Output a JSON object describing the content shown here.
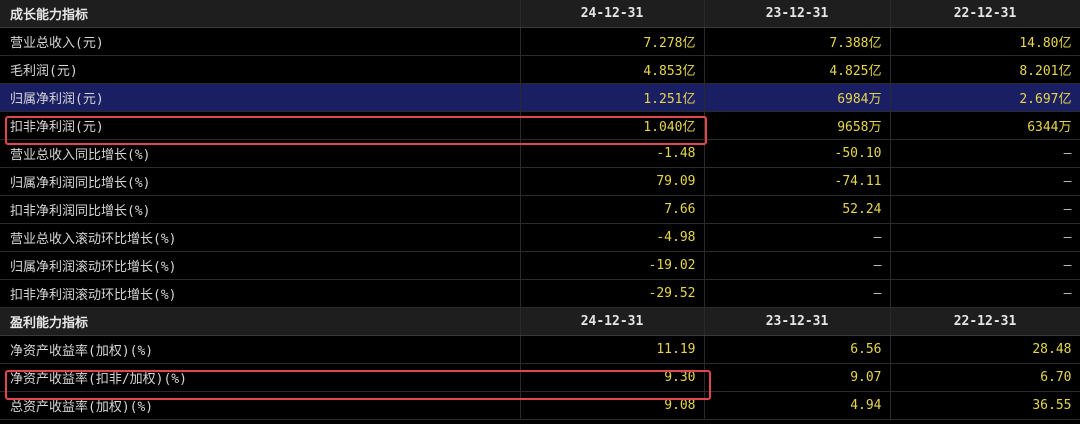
{
  "growth": {
    "header": {
      "title": "成长能力指标",
      "dates": [
        "24-12-31",
        "23-12-31",
        "22-12-31"
      ]
    },
    "rows": [
      {
        "label": "营业总收入(元)",
        "values": [
          "7.278亿",
          "7.388亿",
          "14.80亿"
        ]
      },
      {
        "label": "毛利润(元)",
        "values": [
          "4.853亿",
          "4.825亿",
          "8.201亿"
        ]
      },
      {
        "label": "归属净利润(元)",
        "values": [
          "1.251亿",
          "6984万",
          "2.697亿"
        ]
      },
      {
        "label": "扣非净利润(元)",
        "values": [
          "1.040亿",
          "9658万",
          "6344万"
        ]
      },
      {
        "label": "营业总收入同比增长(%)",
        "values": [
          "-1.48",
          "-50.10",
          "—"
        ]
      },
      {
        "label": "归属净利润同比增长(%)",
        "values": [
          "79.09",
          "-74.11",
          "—"
        ]
      },
      {
        "label": "扣非净利润同比增长(%)",
        "values": [
          "7.66",
          "52.24",
          "—"
        ]
      },
      {
        "label": "营业总收入滚动环比增长(%)",
        "values": [
          "-4.98",
          "—",
          "—"
        ]
      },
      {
        "label": "归属净利润滚动环比增长(%)",
        "values": [
          "-19.02",
          "—",
          "—"
        ]
      },
      {
        "label": "扣非净利润滚动环比增长(%)",
        "values": [
          "-29.52",
          "—",
          "—"
        ]
      }
    ]
  },
  "profit": {
    "header": {
      "title": "盈利能力指标",
      "dates": [
        "24-12-31",
        "23-12-31",
        "22-12-31"
      ]
    },
    "rows": [
      {
        "label": "净资产收益率(加权)(%)",
        "values": [
          "11.19",
          "6.56",
          "28.48"
        ]
      },
      {
        "label": "净资产收益率(扣非/加权)(%)",
        "values": [
          "9.30",
          "9.07",
          "6.70"
        ]
      },
      {
        "label": "总资产收益率(加权)(%)",
        "values": [
          "9.08",
          "4.94",
          "36.55"
        ]
      }
    ]
  },
  "colors": {
    "highlight_row": "#1a1f64",
    "value_text": "#e7d64a",
    "annotation_box": "#e2454e"
  }
}
